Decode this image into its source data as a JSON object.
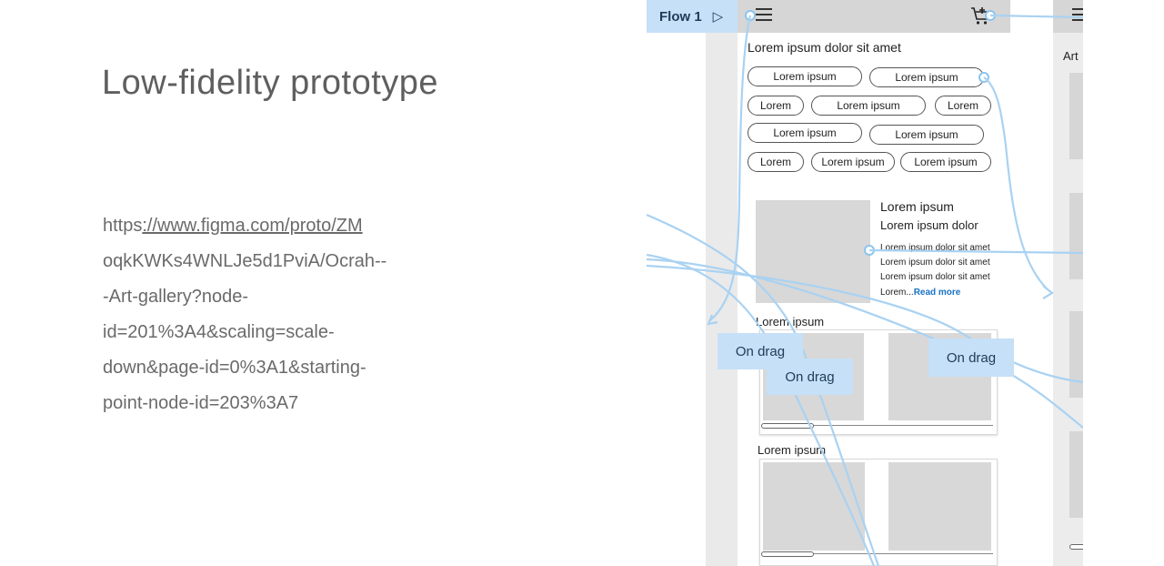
{
  "slide": {
    "title": "Low-fidelity prototype",
    "link_lines": [
      {
        "plain": "https",
        "underlined": "://www.figma.com/proto/ZM"
      },
      {
        "plain": "oqkKWKs4WNLJe5d1PviA/Ocrah--"
      },
      {
        "plain": "-Art-gallery?node-"
      },
      {
        "plain": "id=201%3A4&scaling=scale-"
      },
      {
        "plain": "down&page-id=0%3A1&starting-"
      },
      {
        "plain": "point-node-id=203%3A7"
      }
    ]
  },
  "prototype": {
    "flow_label": "Flow 1",
    "section_heading": "Lorem ipsum dolor sit amet",
    "chips": [
      "Lorem ipsum",
      "Lorem ipsum",
      "Lorem",
      "Lorem ipsum",
      "Lorem",
      "Lorem ipsum",
      "Lorem ipsum",
      "Lorem",
      "Lorem ipsum",
      "Lorem ipsum"
    ],
    "card": {
      "title": "Lorem ipsum",
      "subtitle": "Lorem ipsum dolor",
      "lines": [
        "Lorem ipsum dolor sit amet",
        "Lorem ipsum dolor sit amet",
        "Lorem ipsum dolor sit amet"
      ],
      "ellipsis_text": "Lorem...",
      "read_more": "Read more"
    },
    "carousel_1_title": "Lorem ipsum",
    "carousel_2_title": "Lorem ipsum",
    "drag_labels": [
      "On drag",
      "On drag",
      "On drag"
    ],
    "side_frame_label": "Art"
  },
  "colors": {
    "connector": "#a9d2f2",
    "interaction_label_bg": "#c6e0f7",
    "read_more": "#1a73c7"
  }
}
